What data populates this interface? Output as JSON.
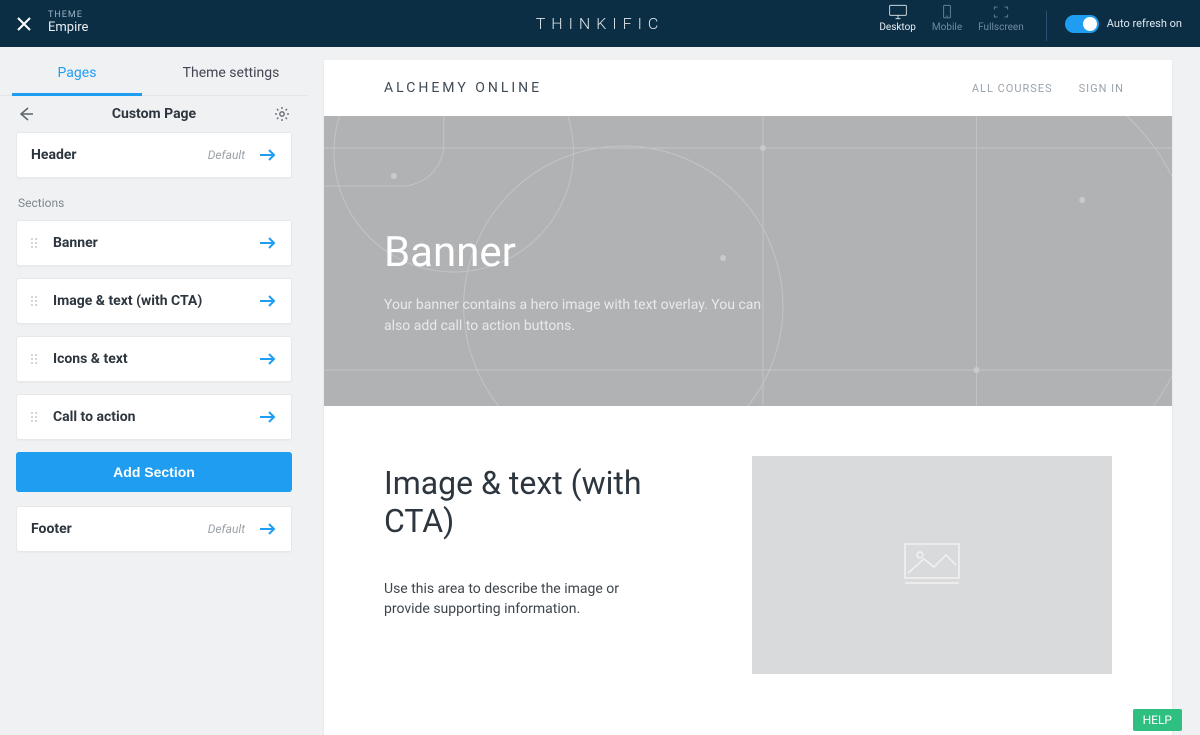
{
  "topbar": {
    "theme_label": "THEME",
    "theme_name": "Empire",
    "brand": "THINKIFIC",
    "devices": {
      "desktop": "Desktop",
      "mobile": "Mobile",
      "fullscreen": "Fullscreen"
    },
    "autorefresh_label": "Auto refresh on"
  },
  "sidebar": {
    "tab_pages": "Pages",
    "tab_theme_settings": "Theme settings",
    "page_title": "Custom Page",
    "header_card": {
      "title": "Header",
      "tag": "Default"
    },
    "sections_label": "Sections",
    "sections": [
      {
        "title": "Banner"
      },
      {
        "title": "Image & text (with CTA)"
      },
      {
        "title": "Icons & text"
      },
      {
        "title": "Call to action"
      }
    ],
    "add_section_label": "Add Section",
    "footer_card": {
      "title": "Footer",
      "tag": "Default"
    }
  },
  "preview": {
    "site_name": "ALCHEMY ONLINE",
    "nav_all_courses": "ALL COURSES",
    "nav_sign_in": "SIGN IN",
    "hero_title": "Banner",
    "hero_text": "Your banner contains a hero image with text overlay. You can also add call to action buttons.",
    "image_text_title": "Image & text (with CTA)",
    "image_text_body": "Use this area to describe the image or provide supporting information."
  },
  "help_label": "HELP"
}
